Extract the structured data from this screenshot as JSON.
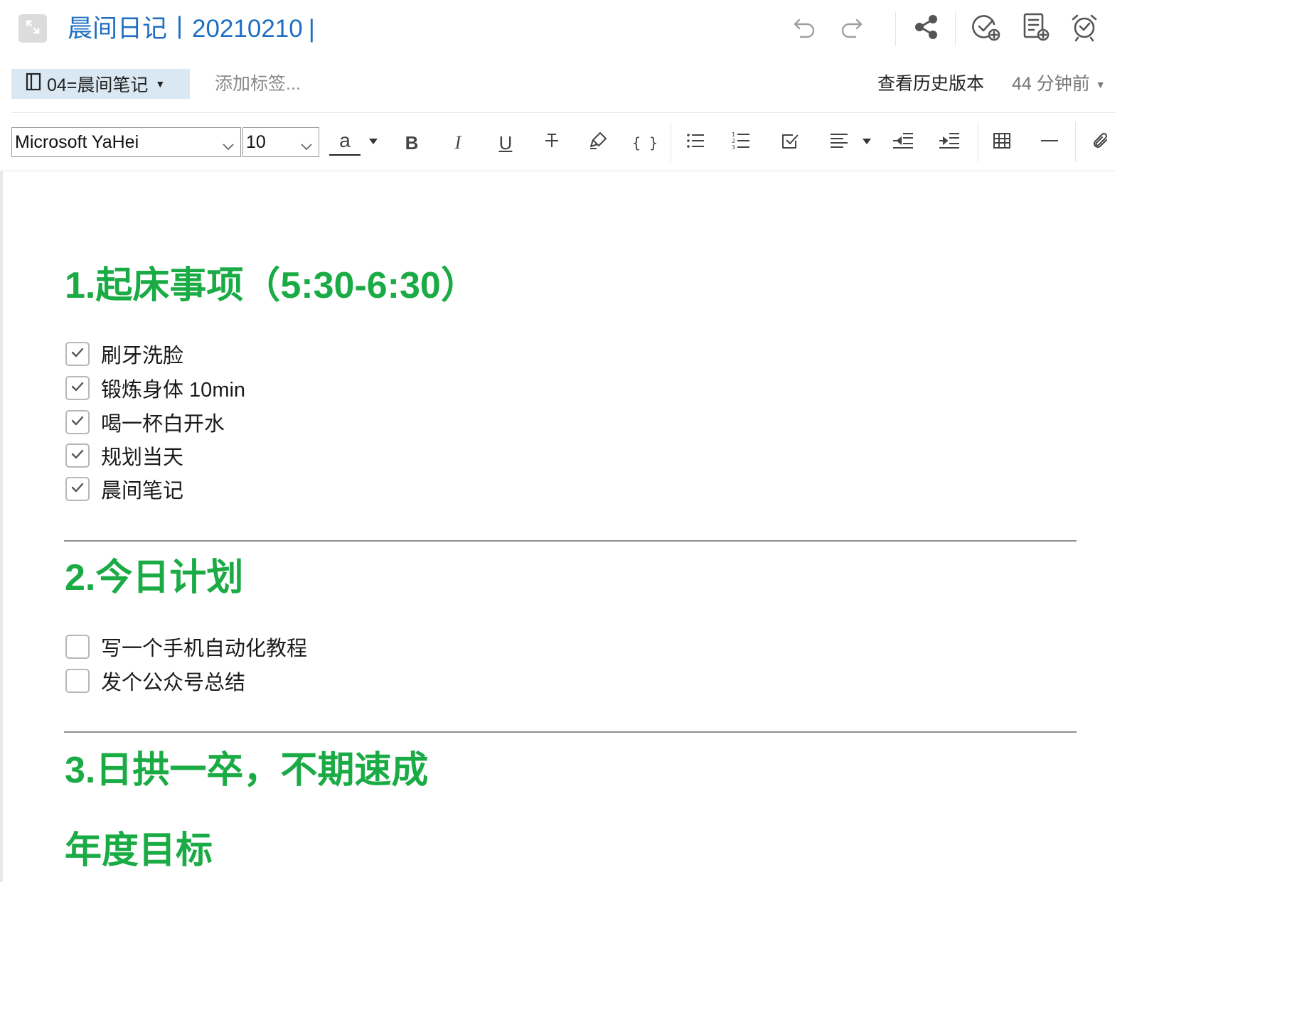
{
  "header": {
    "title": "晨间日记丨20210210",
    "cursor": "|"
  },
  "meta": {
    "notebook": "04=晨间笔记",
    "add_tag_placeholder": "添加标签...",
    "history_label": "查看历史版本",
    "time_ago": "44 分钟前"
  },
  "toolbar": {
    "font_family": "Microsoft YaHei",
    "font_size": "10",
    "font_color_glyph": "a",
    "bold_glyph": "B",
    "italic_glyph": "I",
    "underline_glyph": "U",
    "code_glyph": "{ }"
  },
  "document": {
    "section1": {
      "heading": "1.起床事项（5:30-6:30）",
      "items": [
        {
          "text": "刷牙洗脸",
          "checked": true
        },
        {
          "text": "锻炼身体 10min",
          "checked": true
        },
        {
          "text": "喝一杯白开水",
          "checked": true
        },
        {
          "text": "规划当天",
          "checked": true
        },
        {
          "text": "晨间笔记",
          "checked": true
        }
      ]
    },
    "section2": {
      "heading": "2.今日计划",
      "items": [
        {
          "text": "写一个手机自动化教程",
          "checked": false
        },
        {
          "text": "发个公众号总结",
          "checked": false
        }
      ]
    },
    "section3": {
      "heading": "3.日拱一卒，不期速成"
    },
    "section4": {
      "heading": "年度目标"
    }
  },
  "colors": {
    "title_blue": "#1e6fc2",
    "heading_green": "#1aab45",
    "notebook_bg": "#d9e8f3"
  }
}
